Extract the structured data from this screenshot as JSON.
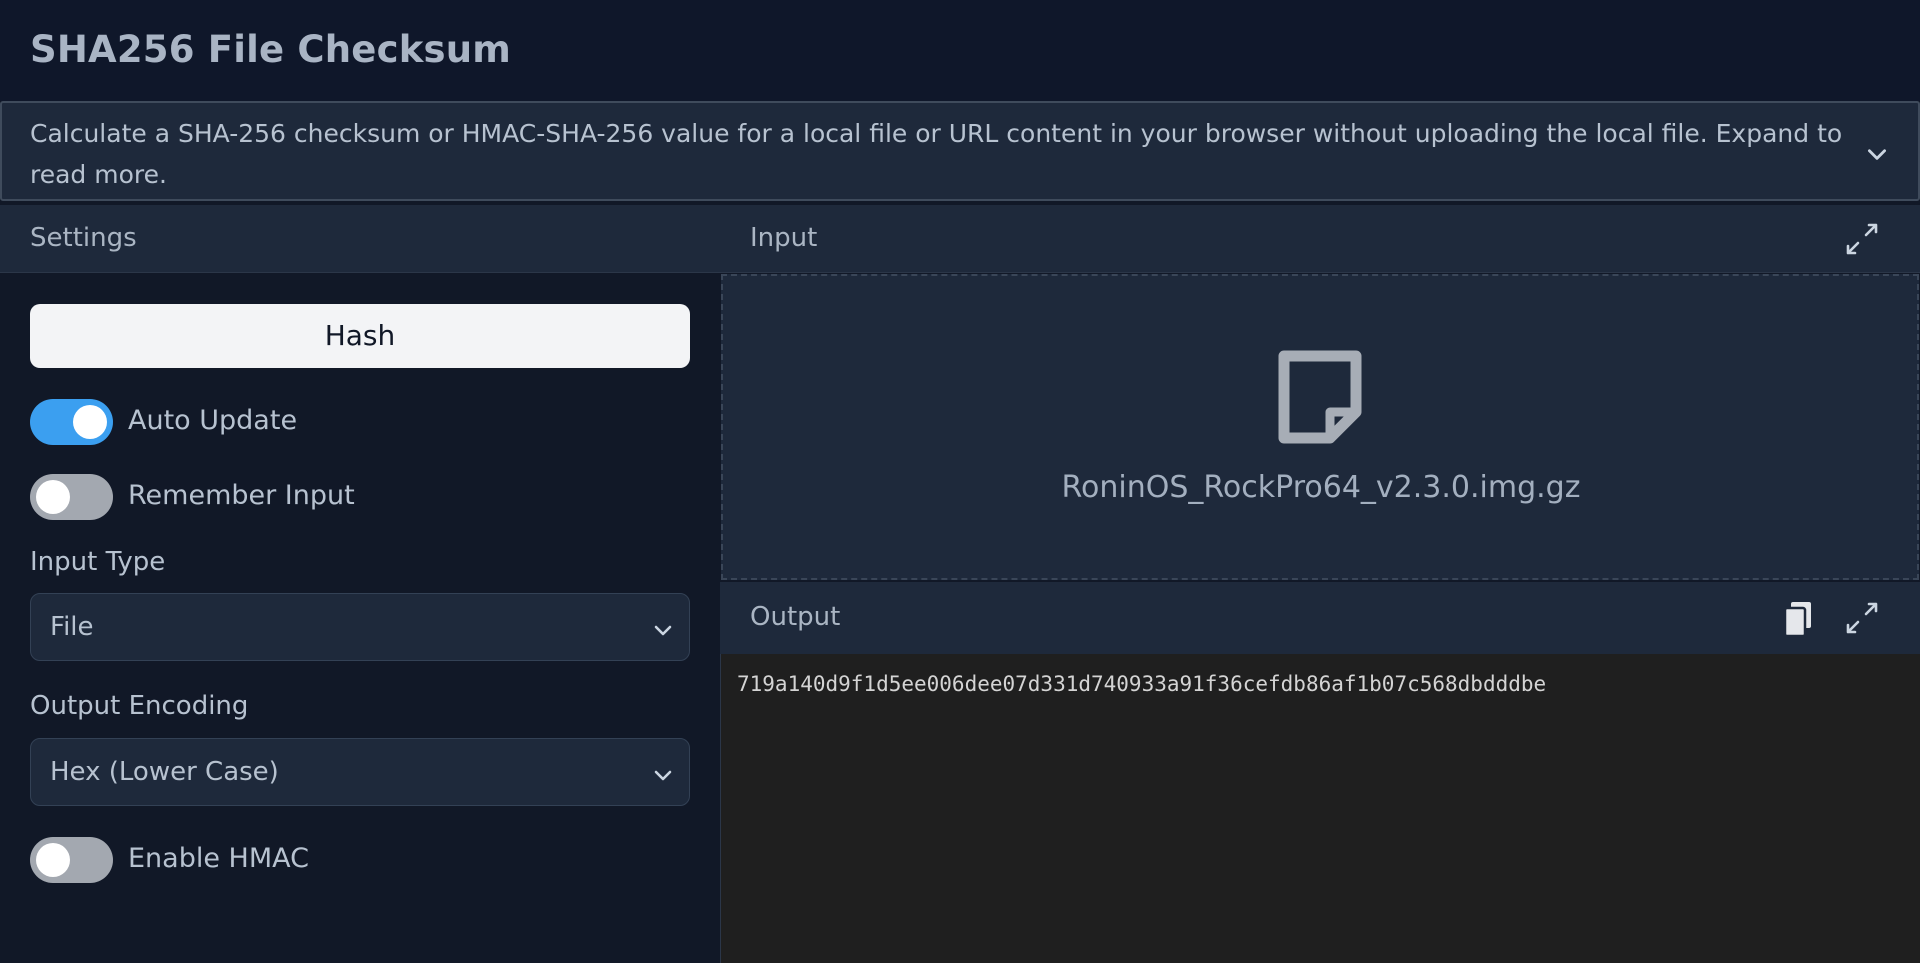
{
  "header": {
    "title": "SHA256 File Checksum"
  },
  "description": {
    "text": "Calculate a SHA-256 checksum or HMAC-SHA-256 value for a local file or URL content in your browser without uploading the local file. Expand to read more."
  },
  "settings": {
    "title": "Settings",
    "hash_button": "Hash",
    "auto_update": {
      "label": "Auto Update",
      "on": true
    },
    "remember_input": {
      "label": "Remember Input",
      "on": false
    },
    "input_type": {
      "label": "Input Type",
      "value": "File"
    },
    "output_encoding": {
      "label": "Output Encoding",
      "value": "Hex (Lower Case)"
    },
    "enable_hmac": {
      "label": "Enable HMAC",
      "on": false
    }
  },
  "input": {
    "title": "Input",
    "file_name": "RoninOS_RockPro64_v2.3.0.img.gz"
  },
  "output": {
    "title": "Output",
    "value": "719a140d9f1d5ee006dee07d331d740933a91f36cefdb86af1b07c568dbdddbe"
  },
  "colors": {
    "accent": "#3b9ff0",
    "background": "#111827",
    "panel": "#1e293b"
  },
  "icons": {
    "expand_description": "chevron-down-icon",
    "fullscreen": "expand-icon",
    "copy": "copy-icon",
    "file": "file-icon"
  }
}
